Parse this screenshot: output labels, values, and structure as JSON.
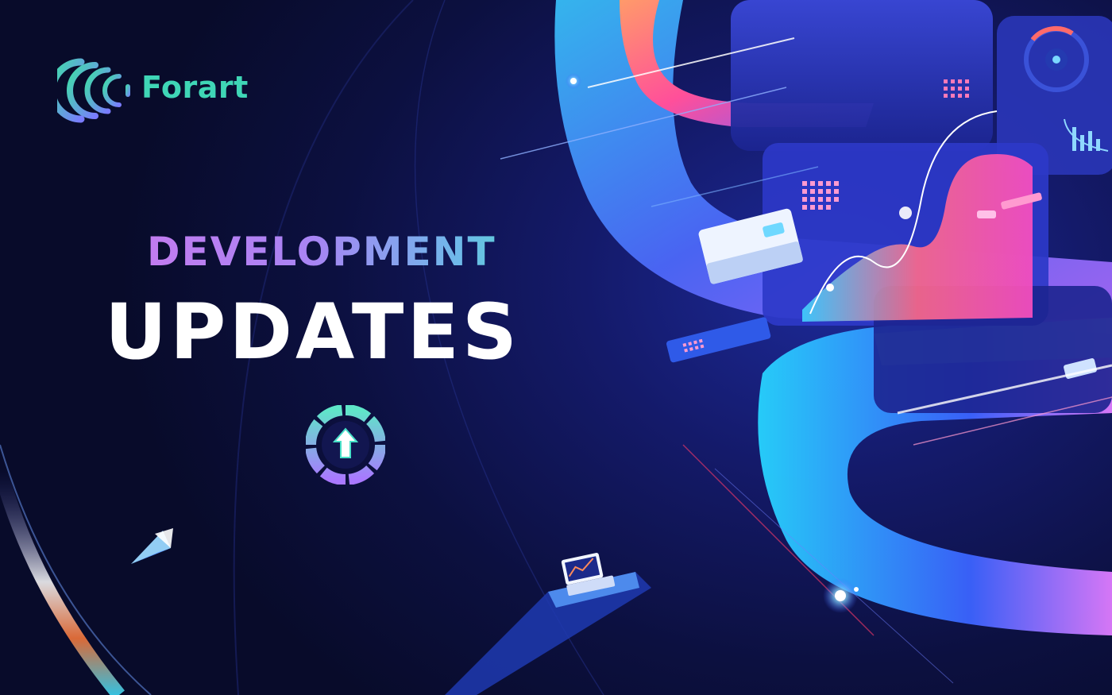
{
  "brand": {
    "name": "Forart",
    "logo_icon": "forart-logo-icon"
  },
  "headline": {
    "line1": "DEVELOPMENT",
    "line2": "UPDATES"
  },
  "badge": {
    "icon": "upload-progress-ring-icon"
  },
  "colors": {
    "background": "#0a0d2e",
    "brand_teal": "#3fd6b6",
    "headline_purple": "#c27cf0",
    "headline_cyan": "#4fe0c8",
    "accent_pink": "#ff5fa2",
    "accent_blue": "#2f7bff"
  }
}
